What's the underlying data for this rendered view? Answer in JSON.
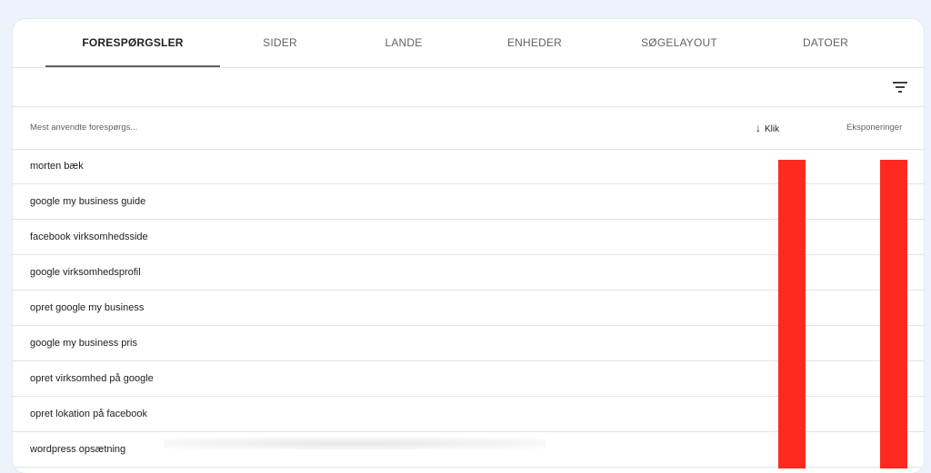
{
  "tabs": [
    {
      "label": "FORESPØRGSLER",
      "active": true
    },
    {
      "label": "SIDER"
    },
    {
      "label": "LANDE"
    },
    {
      "label": "ENHEDER"
    },
    {
      "label": "SØGELAYOUT"
    },
    {
      "label": "DATOER"
    }
  ],
  "toolbar": {
    "filter_icon": "filter-list-icon"
  },
  "table": {
    "columns": {
      "query": "Mest anvendte forespørgs...",
      "clicks": "Klik",
      "clicks_sort_icon": "arrow-down-icon",
      "impressions": "Eksponeringer"
    },
    "rows": [
      {
        "query": "morten bæk"
      },
      {
        "query": "google my business guide"
      },
      {
        "query": "facebook virksomhedsside"
      },
      {
        "query": "google virksomhedsprofil"
      },
      {
        "query": "opret google my business"
      },
      {
        "query": "google my business pris"
      },
      {
        "query": "opret virksomhed på google"
      },
      {
        "query": "opret lokation på facebook"
      },
      {
        "query": "wordpress opsætning"
      }
    ]
  },
  "redaction_color": "#ff2a1f"
}
